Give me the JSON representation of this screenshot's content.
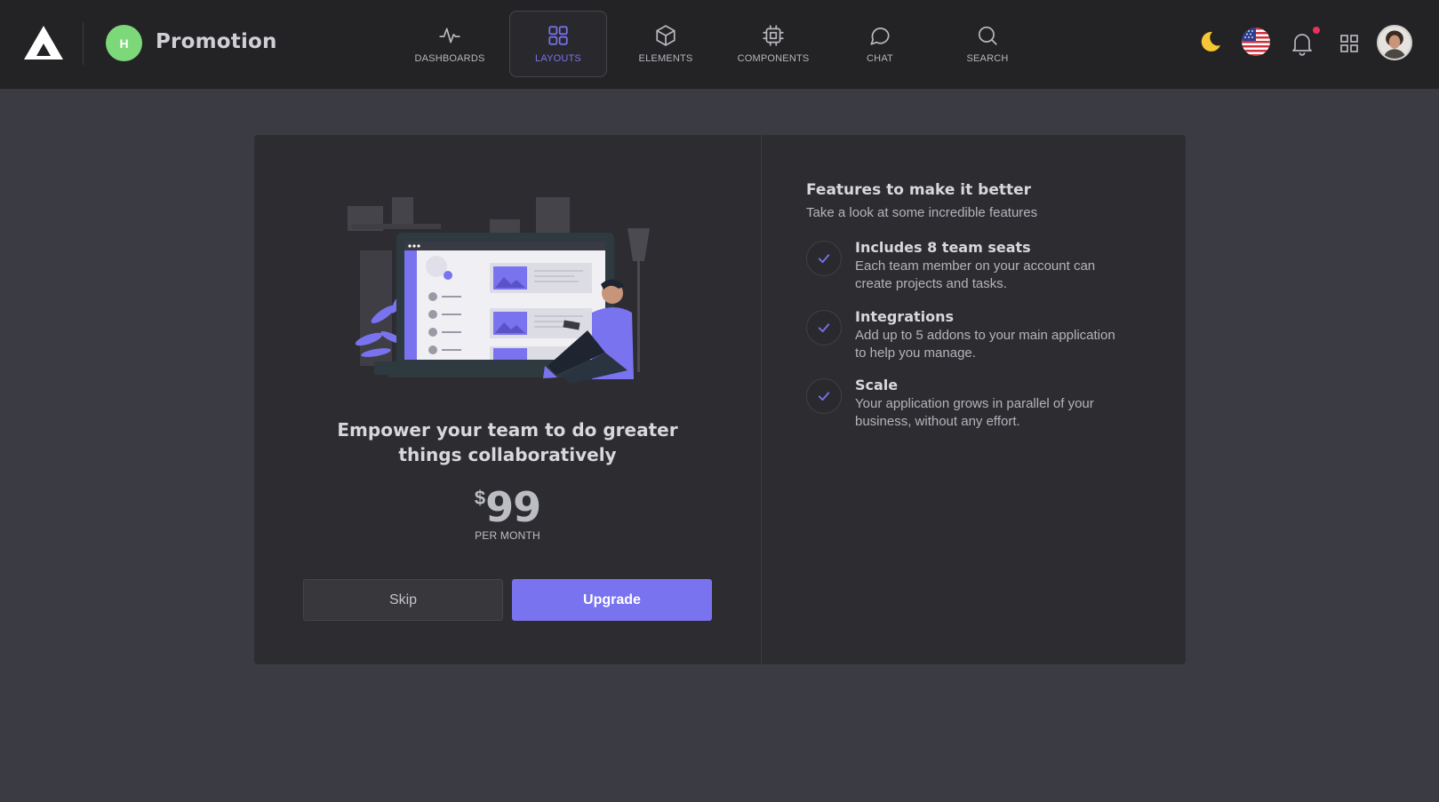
{
  "header": {
    "avatar_letter": "H",
    "title": "Promotion",
    "nav": [
      {
        "label": "DASHBOARDS",
        "icon": "activity-icon",
        "active": false
      },
      {
        "label": "LAYOUTS",
        "icon": "layout-grid-icon",
        "active": true
      },
      {
        "label": "ELEMENTS",
        "icon": "cube-icon",
        "active": false
      },
      {
        "label": "COMPONENTS",
        "icon": "cpu-icon",
        "active": false
      },
      {
        "label": "CHAT",
        "icon": "chat-bubble-icon",
        "active": false
      },
      {
        "label": "SEARCH",
        "icon": "search-icon",
        "active": false
      }
    ],
    "icons": [
      "moon-icon",
      "us-flag-icon",
      "bell-icon",
      "apps-grid-icon",
      "user-avatar"
    ]
  },
  "promo": {
    "headline": "Empower your team to do greater things collaboratively",
    "currency": "$",
    "price": "99",
    "period": "PER MONTH",
    "skip_label": "Skip",
    "upgrade_label": "Upgrade"
  },
  "features": {
    "title": "Features to make it better",
    "subtitle": "Take a look at some incredible features",
    "items": [
      {
        "name": "Includes 8 team seats",
        "desc": "Each team member on your account can create projects and tasks."
      },
      {
        "name": "Integrations",
        "desc": "Add up to 5 addons to your main application to help you manage."
      },
      {
        "name": "Scale",
        "desc": "Your application grows in parallel of your business, without any effort."
      }
    ]
  },
  "colors": {
    "accent": "#7a73ef",
    "topbar": "#232325",
    "background": "#3b3b43",
    "card": "#2d2d31",
    "avatar_green": "#7dd87a",
    "notification": "#e8335b",
    "moon": "#f7c634"
  }
}
